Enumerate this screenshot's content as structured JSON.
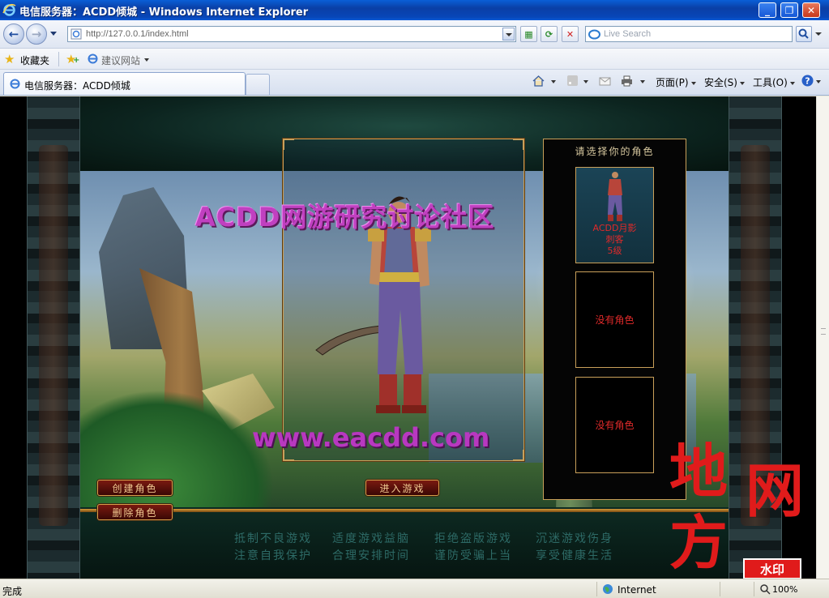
{
  "window": {
    "title": "电信服务器：ACDD倾城 - Windows Internet Explorer",
    "minimize_label": "_",
    "maximize_label": "❐",
    "close_label": "✕"
  },
  "address": {
    "url": "http://127.0.0.1/index.html",
    "search_placeholder": "Live Search"
  },
  "favorites": {
    "label": "收藏夹",
    "suggested_sites": "建议网站"
  },
  "tab": {
    "label": "电信服务器：ACDD倾城"
  },
  "commands": {
    "page": "页面(P)",
    "safety": "安全(S)",
    "tools": "工具(O)"
  },
  "game": {
    "banner_text": "ACDD网游研究讨论社区",
    "url_text": "www.eacdd.com",
    "select_title": "请选择你的角色",
    "slots": [
      {
        "name": "ACDD月影",
        "class": "刺客",
        "level": "5级"
      },
      {
        "empty": "没有角色"
      },
      {
        "empty": "没有角色"
      }
    ],
    "buttons": {
      "create": "创建角色",
      "delete": "删除角色",
      "enter": "进入游戏"
    },
    "slogans": {
      "row1": [
        "抵制不良游戏",
        "适度游戏益脑",
        "拒绝盗版游戏",
        "沉迷游戏伤身"
      ],
      "row2": [
        "注意自我保护",
        "合理安排时间",
        "谨防受骗上当",
        "享受健康生活"
      ]
    }
  },
  "site_watermark": {
    "chars": [
      "地",
      "网",
      "方"
    ],
    "badge": "水印"
  },
  "status": {
    "text": "完成",
    "zone": "Internet",
    "zoom": "100%"
  },
  "colors": {
    "titlebar": "#0a3fa6",
    "slot_text": "#e02a2a",
    "slogan": "#2d6a66",
    "gold": "#c9a05a",
    "watermark_red": "#e01b1b"
  }
}
